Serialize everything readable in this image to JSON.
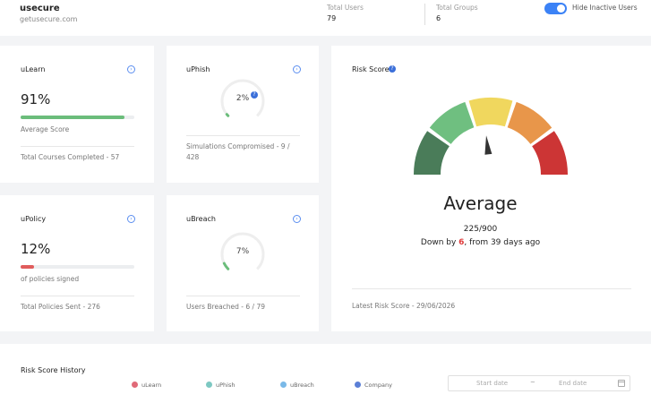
{
  "header": {
    "company_name": "usecure",
    "company_domain": "getusecure.com",
    "total_users_label": "Total Users",
    "total_users_value": "79",
    "total_groups_label": "Total Groups",
    "total_groups_value": "6",
    "hide_inactive_label": "Hide Inactive Users",
    "hide_inactive_on": true
  },
  "ulearn": {
    "title": "uLearn",
    "percent": "91%",
    "progress": 0.91,
    "sub_label": "Average Score",
    "footer": "Total Courses Completed - 57",
    "accent": "#6bbd7b"
  },
  "uphish": {
    "title": "uPhish",
    "percent": "2%",
    "progress": 0.02,
    "footer_line1": "Simulations Compromised - 9 /",
    "footer_line2": "428"
  },
  "upolicy": {
    "title": "uPolicy",
    "percent": "12%",
    "progress": 0.12,
    "sub_label": "of policies signed",
    "footer": "Total Policies Sent - 276",
    "accent": "#e05c5c"
  },
  "ubreach": {
    "title": "uBreach",
    "percent": "7%",
    "progress": 0.07,
    "footer": "Users Breached - 6 / 79"
  },
  "risk": {
    "title": "Risk Score",
    "level": "Average",
    "score": "225/900",
    "change_prefix": "Down by ",
    "change_value": "6",
    "change_suffix": ", from 39 days ago",
    "latest": "Latest Risk Score - 29/06/2026",
    "score_value": 225,
    "score_max": 900,
    "colors": [
      "#4a7c59",
      "#6fbf80",
      "#f0d75e",
      "#e8964a",
      "#cc3535"
    ]
  },
  "history": {
    "title": "Risk Score History",
    "legend": [
      {
        "label": "uLearn",
        "color": "#e06a78"
      },
      {
        "label": "uPhish",
        "color": "#7dc8c2"
      },
      {
        "label": "uBreach",
        "color": "#7ab9e8"
      },
      {
        "label": "Company",
        "color": "#5b7fd6"
      }
    ],
    "start_placeholder": "Start date",
    "separator": "~",
    "end_placeholder": "End date"
  }
}
